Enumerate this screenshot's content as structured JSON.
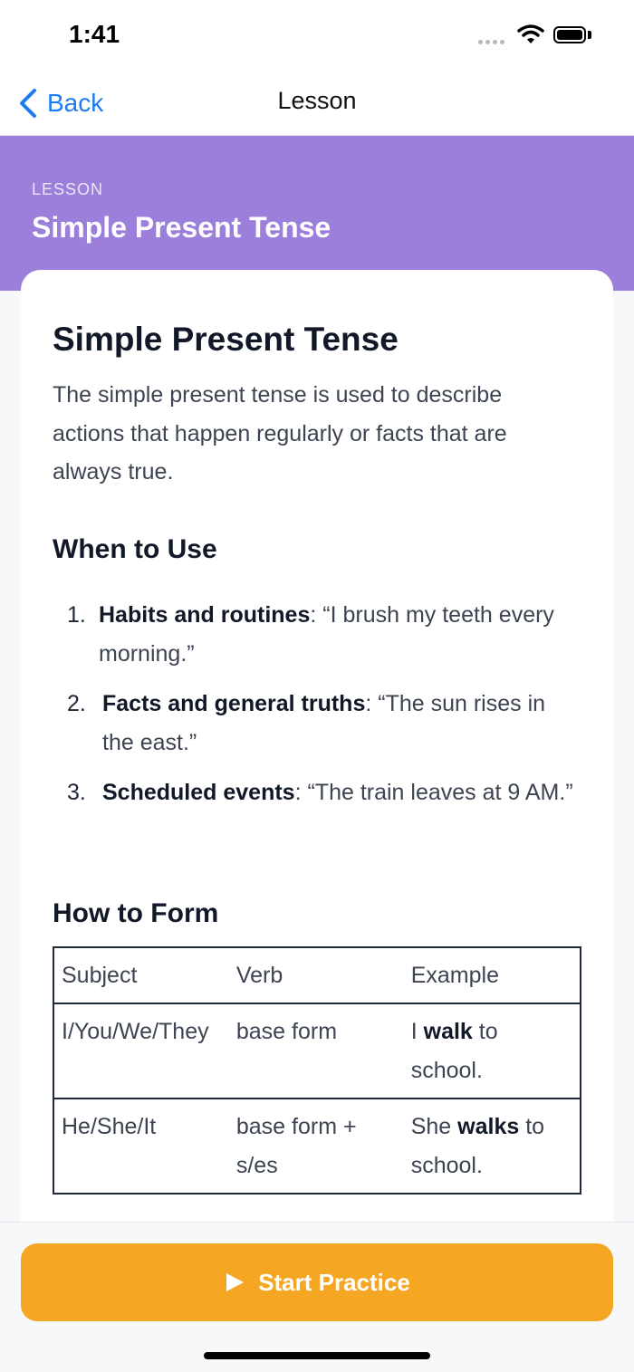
{
  "status_bar": {
    "time": "1:41",
    "icons": [
      "signal-dots-icon",
      "wifi-icon",
      "battery-icon"
    ]
  },
  "navigation": {
    "back_label": "Back",
    "title": "Lesson",
    "back_icon": "chevron-left-icon"
  },
  "header": {
    "kicker": "LESSON",
    "title": "Simple Present Tense",
    "background_color": "#9b7fdb"
  },
  "lesson": {
    "title": "Simple Present Tense",
    "intro": "The simple present tense is used to describe actions that happen regularly or facts that are always true.",
    "when_to_use": {
      "heading": "When to Use",
      "items": [
        {
          "number": "1.",
          "term": "Habits and routines",
          "description": ": “I brush my teeth every morning.”"
        },
        {
          "number": "2.",
          "term": "Facts and general truths",
          "description": ": “The sun rises in the east.”"
        },
        {
          "number": "3.",
          "term": "Scheduled events",
          "description": ": “The train leaves at 9 AM.”"
        }
      ]
    },
    "how_to_form": {
      "heading": "How to Form",
      "columns": [
        "Subject",
        "Verb",
        "Example"
      ],
      "rows": [
        {
          "subject": "I/You/We/They",
          "verb": "base form",
          "example_before": "I ",
          "example_bold": "walk",
          "example_after": " to school."
        },
        {
          "subject": "He/She/It",
          "verb": "base form + s/es",
          "example_before": "She ",
          "example_bold": "walks",
          "example_after": " to school."
        }
      ]
    }
  },
  "footer": {
    "button_label": "Start Practice",
    "button_icon": "play-icon",
    "button_color": "#f5a623"
  }
}
